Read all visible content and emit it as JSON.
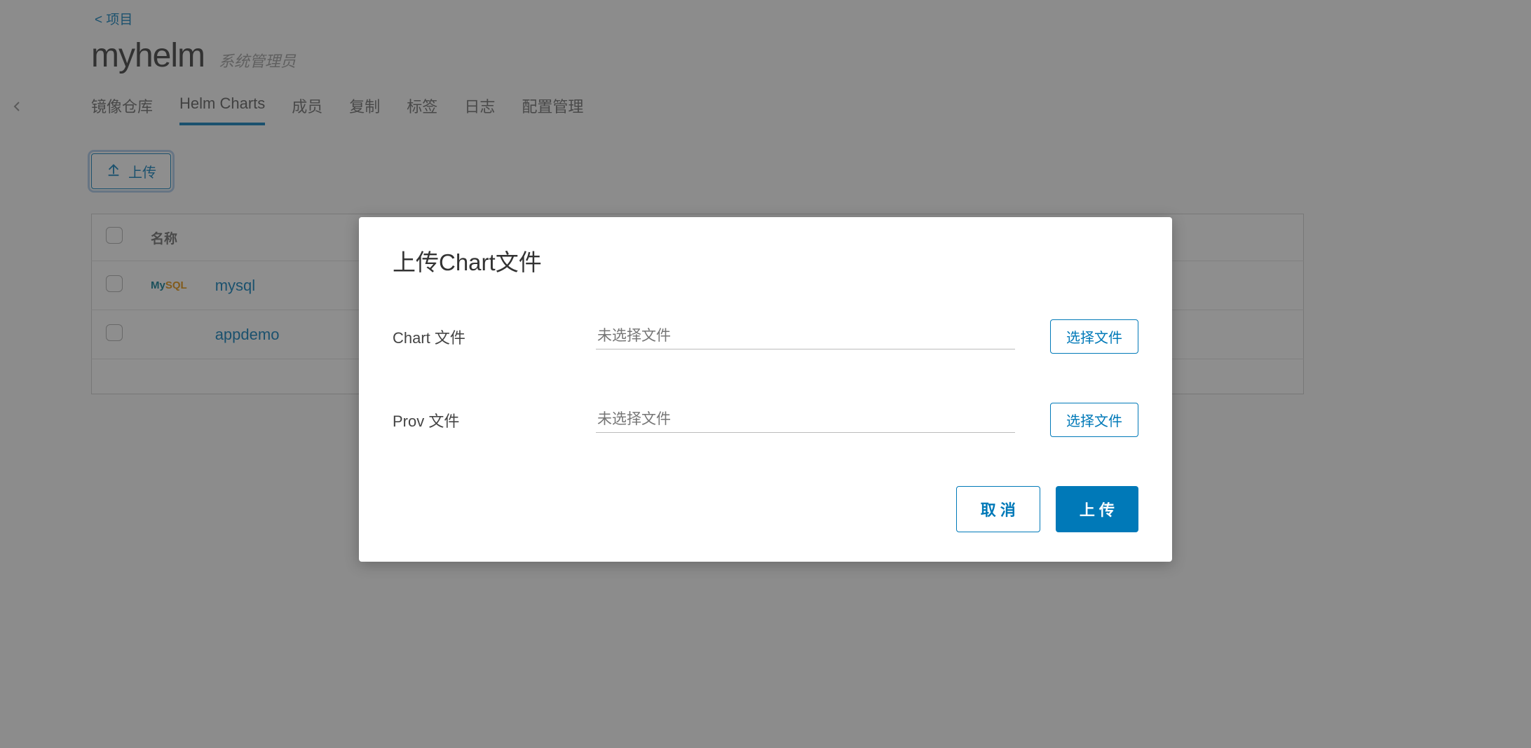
{
  "breadcrumb": {
    "back_label": "< 项目"
  },
  "header": {
    "title": "myhelm",
    "role": "系统管理员"
  },
  "tabs": [
    {
      "label": "镜像仓库",
      "active": false
    },
    {
      "label": "Helm Charts",
      "active": true
    },
    {
      "label": "成员",
      "active": false
    },
    {
      "label": "复制",
      "active": false
    },
    {
      "label": "标签",
      "active": false
    },
    {
      "label": "日志",
      "active": false
    },
    {
      "label": "配置管理",
      "active": false
    }
  ],
  "actions": {
    "upload_label": "上传"
  },
  "table": {
    "columns": {
      "name": "名称"
    },
    "rows": [
      {
        "name": "mysql",
        "icon": "mysql"
      },
      {
        "name": "appdemo",
        "icon": ""
      }
    ]
  },
  "modal": {
    "title": "上传Chart文件",
    "chart_label": "Chart 文件",
    "prov_label": "Prov 文件",
    "placeholder": "未选择文件",
    "select_file": "选择文件",
    "cancel": "取 消",
    "upload": "上 传"
  }
}
